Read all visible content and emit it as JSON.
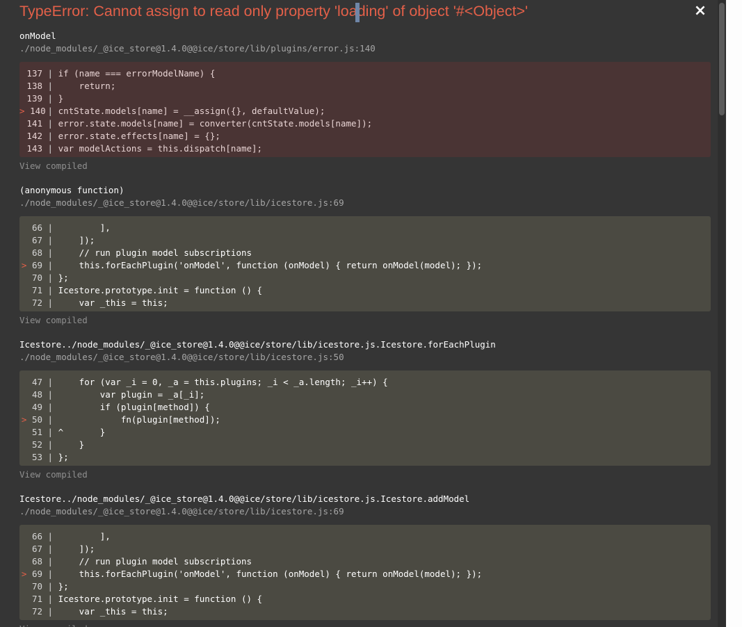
{
  "error": {
    "title": "TypeError: Cannot assign to read only property 'loading' of object '#<Object>'",
    "close_label": "×"
  },
  "frames": [
    {
      "name": "onModel",
      "path": "./node_modules/_@ice_store@1.4.0@@ice/store/lib/plugins/error.js:140",
      "highlight": true,
      "lines": [
        {
          "num": "137",
          "marker": "",
          "code": "if (name === errorModelName) {"
        },
        {
          "num": "138",
          "marker": "",
          "code": "    return;"
        },
        {
          "num": "139",
          "marker": "",
          "code": "}"
        },
        {
          "num": "140",
          "marker": ">",
          "code": "cntState.models[name] = __assign({}, defaultValue);"
        },
        {
          "num": "141",
          "marker": "",
          "code": "error.state.models[name] = converter(cntState.models[name]);"
        },
        {
          "num": "142",
          "marker": "",
          "code": "error.state.effects[name] = {};"
        },
        {
          "num": "143",
          "marker": "",
          "code": "var modelActions = this.dispatch[name];"
        }
      ],
      "view_compiled": "View compiled"
    },
    {
      "name": "(anonymous function)",
      "path": "./node_modules/_@ice_store@1.4.0@@ice/store/lib/icestore.js:69",
      "highlight": false,
      "lines": [
        {
          "num": "66",
          "marker": "",
          "code": "        ],"
        },
        {
          "num": "67",
          "marker": "",
          "code": "    ]);"
        },
        {
          "num": "68",
          "marker": "",
          "code": "    // run plugin model subscriptions"
        },
        {
          "num": "69",
          "marker": ">",
          "code": "    this.forEachPlugin('onModel', function (onModel) { return onModel(model); });"
        },
        {
          "num": "70",
          "marker": "",
          "code": "};"
        },
        {
          "num": "71",
          "marker": "",
          "code": "Icestore.prototype.init = function () {"
        },
        {
          "num": "72",
          "marker": "",
          "code": "    var _this = this;"
        }
      ],
      "view_compiled": "View compiled"
    },
    {
      "name": "Icestore../node_modules/_@ice_store@1.4.0@@ice/store/lib/icestore.js.Icestore.forEachPlugin",
      "path": "./node_modules/_@ice_store@1.4.0@@ice/store/lib/icestore.js:50",
      "highlight": false,
      "lines": [
        {
          "num": "47",
          "marker": "",
          "code": "    for (var _i = 0, _a = this.plugins; _i < _a.length; _i++) {"
        },
        {
          "num": "48",
          "marker": "",
          "code": "        var plugin = _a[_i];"
        },
        {
          "num": "49",
          "marker": "",
          "code": "        if (plugin[method]) {"
        },
        {
          "num": "50",
          "marker": ">",
          "code": "            fn(plugin[method]);"
        },
        {
          "num": "51",
          "marker": "",
          "code": "^       }"
        },
        {
          "num": "52",
          "marker": "",
          "code": "    }"
        },
        {
          "num": "53",
          "marker": "",
          "code": "};"
        }
      ],
      "view_compiled": "View compiled"
    },
    {
      "name": "Icestore../node_modules/_@ice_store@1.4.0@@ice/store/lib/icestore.js.Icestore.addModel",
      "path": "./node_modules/_@ice_store@1.4.0@@ice/store/lib/icestore.js:69",
      "highlight": false,
      "lines": [
        {
          "num": "66",
          "marker": "",
          "code": "        ],"
        },
        {
          "num": "67",
          "marker": "",
          "code": "    ]);"
        },
        {
          "num": "68",
          "marker": "",
          "code": "    // run plugin model subscriptions"
        },
        {
          "num": "69",
          "marker": ">",
          "code": "    this.forEachPlugin('onModel', function (onModel) { return onModel(model); });"
        },
        {
          "num": "70",
          "marker": "",
          "code": "};"
        },
        {
          "num": "71",
          "marker": "",
          "code": "Icestore.prototype.init = function () {"
        },
        {
          "num": "72",
          "marker": "",
          "code": "    var _this = this;"
        }
      ],
      "view_compiled": "View compiled"
    }
  ]
}
